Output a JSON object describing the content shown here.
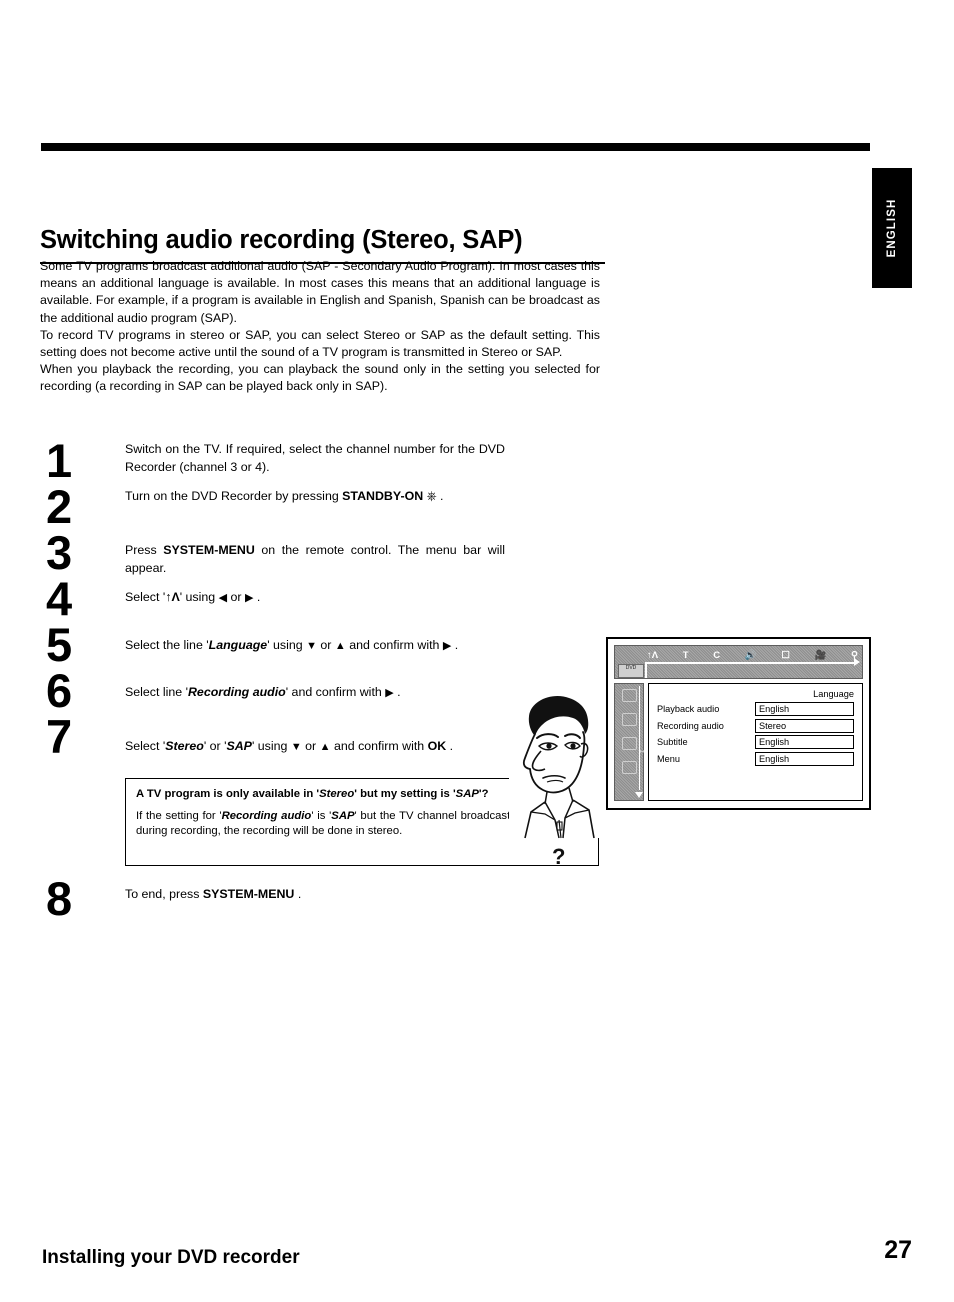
{
  "side_tab": {
    "label": "ENGLISH"
  },
  "title": "Switching audio recording (Stereo, SAP)",
  "intro": {
    "p1": "Some TV programs broadcast additional audio (SAP - Secondary Audio Program). In most cases this means an additional language is available. In most cases this means that an additional language is available. For example, if a program is available in English and Spanish, Spanish can be broadcast as the additional audio program (SAP).",
    "p2": "To record TV programs in stereo or SAP, you can select Stereo or SAP as the default setting. This setting does not become active until the sound of a TV program is transmitted in Stereo or SAP.",
    "p3": "When you playback the recording, you can playback the sound only in the setting you selected for recording (a recording in SAP can be played back only in SAP)."
  },
  "steps": {
    "numbers": [
      "1",
      "2",
      "3",
      "4",
      "5",
      "6",
      "7",
      "8"
    ],
    "s1": "Switch on the TV. If required, select the channel number for the DVD Recorder (channel 3 or 4).",
    "s2_pre": "Turn on the DVD Recorder by pressing ",
    "s2_key": "STANDBY-ON",
    "s2_icon": "power-icon",
    "s2_post": " .",
    "s3_pre": "Press ",
    "s3_key": "SYSTEM-MENU",
    "s3_post": " on the remote control. The menu bar will appear.",
    "s4_pre": "Select '",
    "s4_symbol": "language-icon",
    "s4_mid": "' using ",
    "s4_left": "left-arrow-icon",
    "s4_or": " or ",
    "s4_right": "right-arrow-icon",
    "s4_post": " .",
    "s5_pre": "Select the line '",
    "s5_item": "Language",
    "s5_mid": "' using ",
    "s5_down": "down-arrow-icon",
    "s5_or": " or ",
    "s5_up": "up-arrow-icon",
    "s5_mid2": " and confirm with ",
    "s5_right": "right-arrow-icon",
    "s5_post": " .",
    "s6_pre": "Select line '",
    "s6_item": "Recording audio",
    "s6_mid": "' and confirm with ",
    "s6_right": "right-arrow-icon",
    "s6_post": " .",
    "s7_pre": "Select '",
    "s7_item1": "Stereo",
    "s7_mid1": "' or '",
    "s7_item2": "SAP",
    "s7_mid2": "' using ",
    "s7_down": "down-arrow-icon",
    "s7_or": " or ",
    "s7_up": "up-arrow-icon",
    "s7_mid3": " and confirm with ",
    "s7_key": "OK",
    "s7_post": " .",
    "s8_pre": "To end, press ",
    "s8_key": "SYSTEM-MENU",
    "s8_post": " ."
  },
  "note": {
    "question_a": "A TV program is only available in '",
    "question_item1": "Stereo",
    "question_b": "' but my setting is '",
    "question_item2": "SAP",
    "question_c": "'?",
    "answer_a": "If the setting for '",
    "answer_item1": "Recording audio",
    "answer_b": "' is '",
    "answer_item2": "SAP",
    "answer_c": "' but the TV channel broadcasts only in stereo during recording, the recording will be done in stereo.",
    "cartoon_mark": "?"
  },
  "tv_screen": {
    "menubar_icons": [
      "language-icon",
      "T",
      "C",
      "sound-icon",
      "screen-icon",
      "camera-icon",
      "search-icon"
    ],
    "dvd_tag": "DVD",
    "panel_title": "Language",
    "rows": [
      {
        "label": "Playback audio",
        "value": "English"
      },
      {
        "label": "Recording audio",
        "value": "Stereo"
      },
      {
        "label": "Subtitle",
        "value": "English"
      },
      {
        "label": "Menu",
        "value": "English"
      }
    ],
    "sidebar_icons": [
      "picture-icon",
      "sound-icon",
      "language-icon",
      "features-icon"
    ]
  },
  "footer": {
    "section": "Installing your DVD recorder",
    "page_number": "27"
  }
}
